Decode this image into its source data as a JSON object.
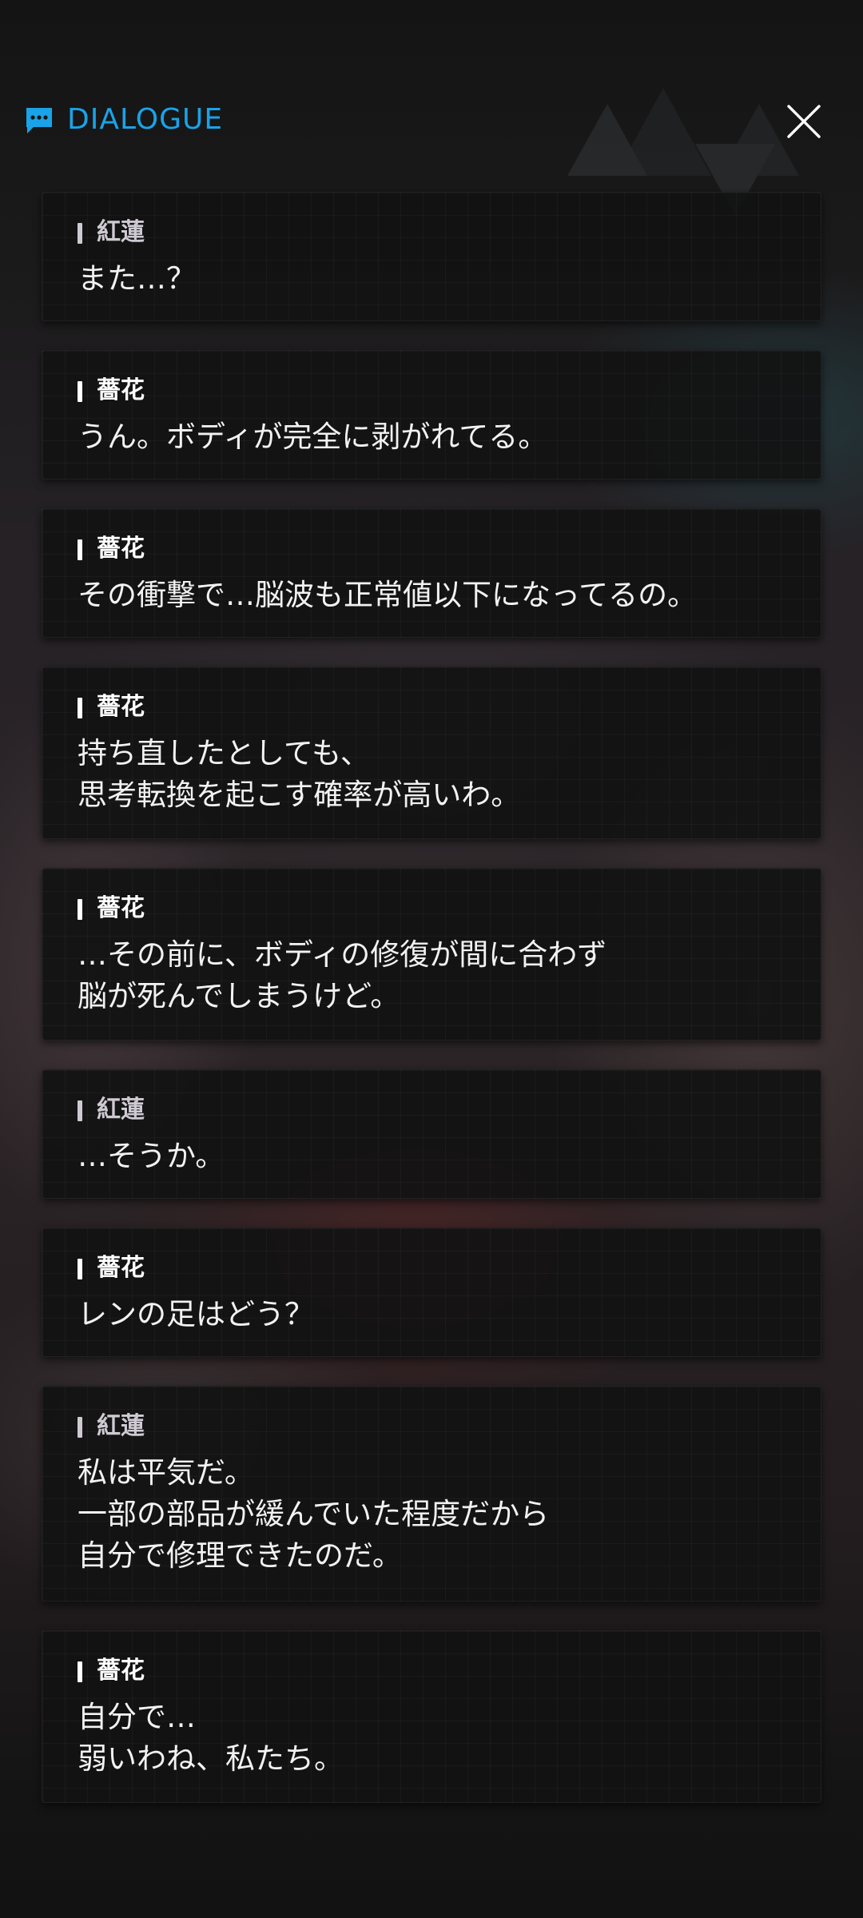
{
  "header": {
    "title": "DIALOGUE",
    "icon": "chat-bubble-icon",
    "accent_color": "#1aa3e8",
    "close_icon": "close-icon"
  },
  "speaker_colors": {
    "紅蓮": "#cfcad2",
    "薔花": "#ffffff"
  },
  "dialogue": [
    {
      "speaker": "紅蓮",
      "lines": [
        "また…？"
      ]
    },
    {
      "speaker": "薔花",
      "lines": [
        "うん。ボディが完全に剥がれてる。"
      ]
    },
    {
      "speaker": "薔花",
      "lines": [
        "その衝撃で…脳波も正常値以下になってるの。"
      ]
    },
    {
      "speaker": "薔花",
      "lines": [
        "持ち直したとしても、",
        "思考転換を起こす確率が高いわ。"
      ]
    },
    {
      "speaker": "薔花",
      "lines": [
        "…その前に、ボディの修復が間に合わず",
        "脳が死んでしまうけど。"
      ]
    },
    {
      "speaker": "紅蓮",
      "lines": [
        "…そうか。"
      ]
    },
    {
      "speaker": "薔花",
      "lines": [
        "レンの足はどう？"
      ]
    },
    {
      "speaker": "紅蓮",
      "lines": [
        "私は平気だ。",
        "一部の部品が緩んでいた程度だから",
        "自分で修理できたのだ。"
      ]
    },
    {
      "speaker": "薔花",
      "lines": [
        "自分で…",
        "弱いわね、私たち。"
      ]
    }
  ]
}
